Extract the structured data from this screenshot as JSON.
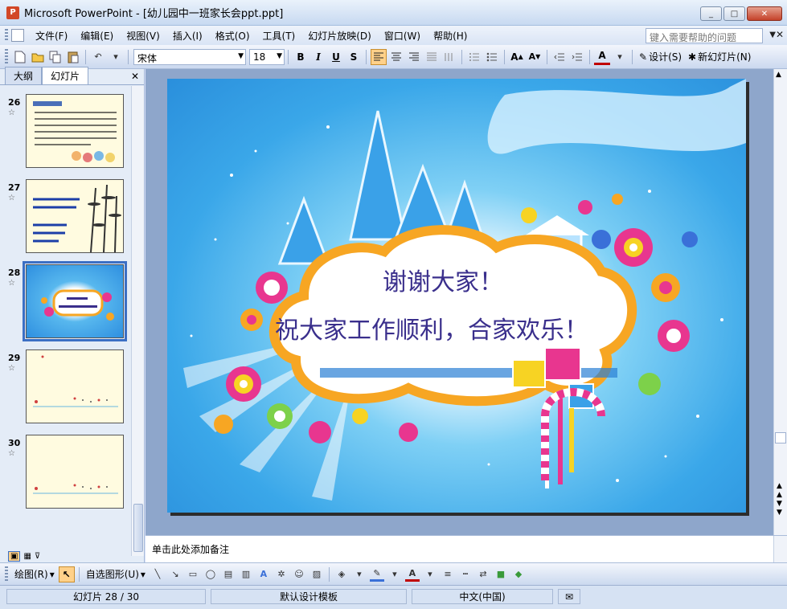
{
  "window": {
    "title": "Microsoft PowerPoint - [幼儿园中一班家长会ppt.ppt]",
    "minimize": "_",
    "maximize": "□",
    "close": "✕"
  },
  "menu": {
    "items": [
      "文件(F)",
      "编辑(E)",
      "视图(V)",
      "插入(I)",
      "格式(O)",
      "工具(T)",
      "幻灯片放映(D)",
      "窗口(W)",
      "帮助(H)"
    ],
    "help_placeholder": "键入需要帮助的问题"
  },
  "toolbar": {
    "font": "宋体",
    "size": "18",
    "design_label": "设计(S)",
    "new_slide_label": "新幻灯片(N)"
  },
  "panel": {
    "tabs": [
      "大纲",
      "幻灯片"
    ],
    "active_tab": 1,
    "thumbnails": [
      {
        "number": "26"
      },
      {
        "number": "27"
      },
      {
        "number": "28"
      },
      {
        "number": "29"
      },
      {
        "number": "30"
      }
    ],
    "selected_index": 2
  },
  "slide": {
    "line1": "谢谢大家！",
    "line2": "祝大家工作顺利，合家欢乐！"
  },
  "notes": {
    "placeholder": "单击此处添加备注"
  },
  "drawbar": {
    "draw_label": "绘图(R)",
    "autoshapes_label": "自选图形(U)"
  },
  "status": {
    "slide_info": "幻灯片 28 / 30",
    "template": "默认设计模板",
    "language": "中文(中国)"
  },
  "colors": {
    "accent": "#3b6fc4",
    "slide_text": "#3a2f8c",
    "titlebar": "#c7d9f1"
  }
}
